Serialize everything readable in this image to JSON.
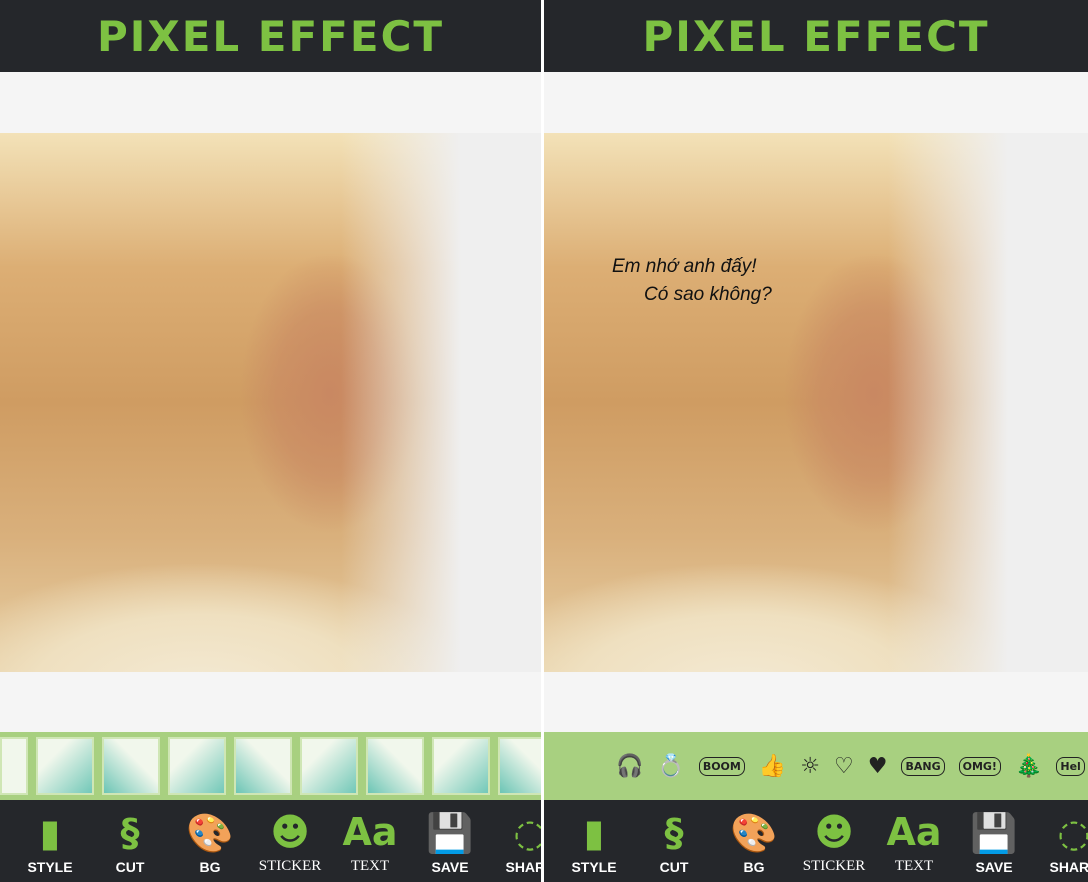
{
  "app_title": "PIXEL EFFECT",
  "caption": {
    "line1": "Em nhớ anh đấy!",
    "line2": "Có sao không?"
  },
  "background_thumbnails": 9,
  "stickers": [
    {
      "icon": "headphones-icon",
      "glyph": "🎧"
    },
    {
      "icon": "ring-icon",
      "glyph": "💍"
    },
    {
      "icon": "boom-sticker",
      "text": "BOOM"
    },
    {
      "icon": "thumbs-up-icon",
      "glyph": "👍"
    },
    {
      "icon": "sun-icon",
      "glyph": "☼"
    },
    {
      "icon": "hearts-icon",
      "glyph": "♡"
    },
    {
      "icon": "small-hearts-icon",
      "glyph": "♥"
    },
    {
      "icon": "bang-sticker",
      "text": "BANG"
    },
    {
      "icon": "omg-sticker",
      "text": "OMG!"
    },
    {
      "icon": "tree-icon",
      "glyph": "🎄"
    },
    {
      "icon": "hello-sticker",
      "text": "Hel"
    }
  ],
  "toolbar": [
    {
      "label": "STYLE",
      "icon": "style-icon",
      "glyph": "▮"
    },
    {
      "label": "CUT",
      "icon": "cut-icon",
      "glyph": "§"
    },
    {
      "label": "BG",
      "icon": "palette-icon",
      "glyph": "🎨"
    },
    {
      "label": "STICKER",
      "icon": "smiley-icon",
      "glyph": "☻"
    },
    {
      "label": "TEXT",
      "icon": "text-icon",
      "glyph": "Aa"
    },
    {
      "label": "SAVE",
      "icon": "floppy-disk-icon",
      "glyph": "💾"
    },
    {
      "label": "SHARE",
      "icon": "share-icon",
      "glyph": "◌"
    }
  ],
  "colors": {
    "accent": "#7dc142",
    "bar": "#25272b",
    "strip": "#a8d080"
  }
}
